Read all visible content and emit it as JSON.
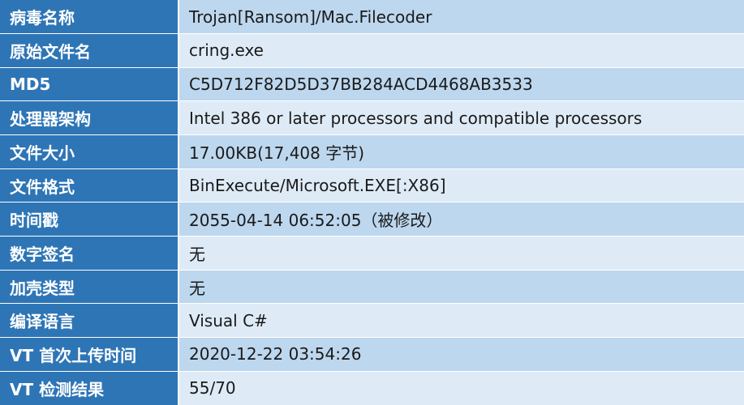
{
  "rows": [
    {
      "label": "病毒名称",
      "value": "Trojan[Ransom]/Mac.Filecoder"
    },
    {
      "label": "原始文件名",
      "value": "cring.exe"
    },
    {
      "label": "MD5",
      "value": "C5D712F82D5D37BB284ACD4468AB3533"
    },
    {
      "label": "处理器架构",
      "value": "Intel 386 or later processors and compatible processors"
    },
    {
      "label": "文件大小",
      "value": "17.00KB(17,408 字节)"
    },
    {
      "label": "文件格式",
      "value": "BinExecute/Microsoft.EXE[:X86]"
    },
    {
      "label": "时间戳",
      "value": "2055-04-14 06:52:05（被修改）"
    },
    {
      "label": "数字签名",
      "value": "无"
    },
    {
      "label": "加壳类型",
      "value": "无"
    },
    {
      "label": "编译语言",
      "value": "Visual C#"
    },
    {
      "label": "VT 首次上传时间",
      "value": "2020-12-22 03:54:26"
    },
    {
      "label": "VT 检测结果",
      "value": "55/70"
    }
  ],
  "colors": {
    "label_bg": "#2e75b6",
    "value_bg_dark": "#bdd7ee",
    "value_bg_light": "#deebf7"
  }
}
